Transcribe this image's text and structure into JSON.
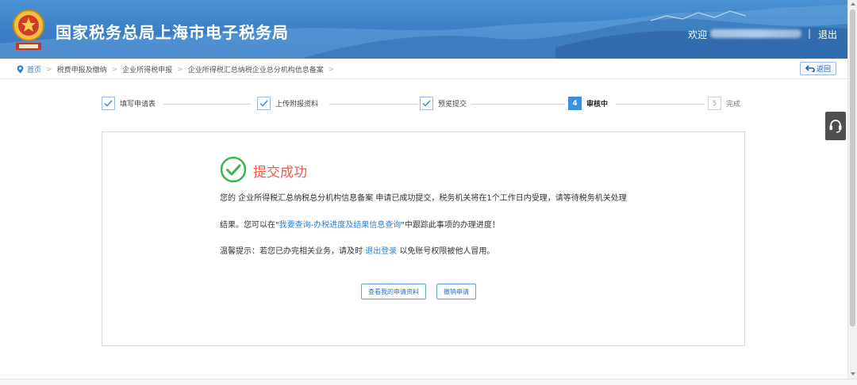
{
  "header": {
    "site_title": "国家税务总局上海市电子税务局",
    "welcome": "欢迎",
    "divider": "|",
    "logout": "退出"
  },
  "breadcrumb": {
    "items": [
      "首页",
      "税费申报及缴纳",
      "企业所得税申报",
      "企业所得税汇总纳税企业总分机构信息备案"
    ],
    "separator": ">",
    "back_label": "返回"
  },
  "steps": [
    {
      "label": "填写申请表",
      "status": "done"
    },
    {
      "label": "上传附报资料",
      "status": "done"
    },
    {
      "label": "预览提交",
      "status": "done"
    },
    {
      "label": "审核中",
      "status": "current",
      "number": "4"
    },
    {
      "label": "完成",
      "status": "pending",
      "number": "5"
    }
  ],
  "result": {
    "title": "提交成功",
    "line1": "您的 企业所得税汇总纳税总分机构信息备案 申请已成功提交，税务机关将在1个工作日内受理，请等待税务机关处理",
    "line2_prefix": "结果。您可以在\"",
    "line2_link": "我要查询-办税进度及结果信息查询",
    "line2_suffix": "\"中跟踪此事项的办理进度！",
    "tip_prefix": "温馨提示：若您已办完相关业务，请及时 ",
    "tip_link": "退出登录",
    "tip_suffix": " 以免账号权限被他人冒用。",
    "view_button": "查看我的申请资料",
    "cancel_button": "撤销申请"
  },
  "colors": {
    "header_blue": "#3a7fc6",
    "link_blue": "#2f80d1",
    "success_green": "#3bb54a",
    "title_red": "#f2574e",
    "step_current": "#3d8fe0"
  },
  "icons": {
    "logo": "tax-emblem-icon",
    "home": "location-pin-icon",
    "back": "return-arrow-icon",
    "help": "headset-icon",
    "success": "check-circle-icon",
    "step_done": "checkmark-icon"
  }
}
